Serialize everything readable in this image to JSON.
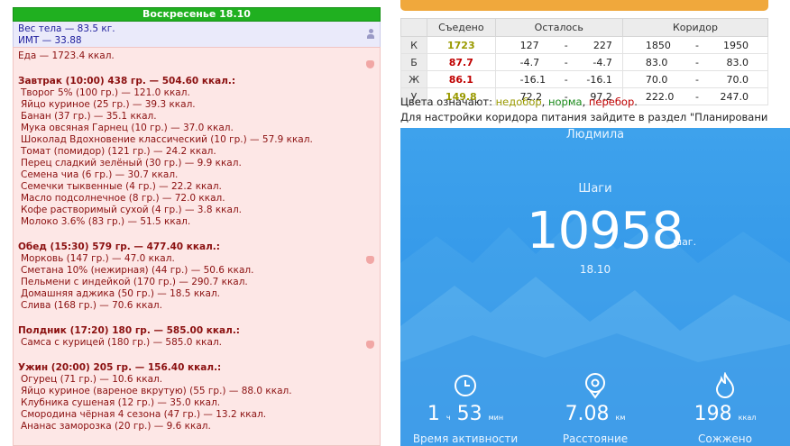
{
  "day_header": "Воскресенье 18.10",
  "weight": {
    "line1": "Вес тела — 83.5 кг.",
    "line2": "ИМТ — 33.88"
  },
  "food_total": "Еда — 1723.4 ккал.",
  "meals": [
    {
      "title": "Завтрак (10:00) 438 гр. — 504.60 ккал.:",
      "items": [
        "Творог 5% (100 гр.) — 121.0 ккал.",
        "Яйцо куриное (25 гр.) — 39.3 ккал.",
        "Банан (37 гр.) — 35.1 ккал.",
        "Мука овсяная Гарнец (10 гр.) — 37.0 ккал.",
        "Шоколад Вдохновение классический (10 гр.) — 57.9 ккал.",
        "Томат (помидор) (121 гр.) — 24.2 ккал.",
        "Перец сладкий зелёный (30 гр.) — 9.9 ккал.",
        "Семена чиа (6 гр.) — 30.7 ккал.",
        "Семечки тыквенные (4 гр.) — 22.2 ккал.",
        "Масло подсолнечное (8 гр.) — 72.0 ккал.",
        "Кофе растворимый сухой (4 гр.) — 3.8 ккал.",
        "Молоко 3.6% (83 гр.) — 51.5 ккал."
      ]
    },
    {
      "title": "Обед (15:30) 579 гр. — 477.40 ккал.:",
      "items": [
        "Морковь (147 гр.) — 47.0 ккал.",
        "Сметана 10% (нежирная) (44 гр.) — 50.6 ккал.",
        "Пельмени с индейкой (170 гр.) — 290.7 ккал.",
        "Домашняя аджика (50 гр.) — 18.5 ккал.",
        "Слива (168 гр.) — 70.6 ккал."
      ]
    },
    {
      "title": "Полдник (17:20) 180 гр. — 585.00 ккал.:",
      "items": [
        "Самса с курицей (180 гр.) — 585.0 ккал."
      ]
    },
    {
      "title": "Ужин (20:00) 205 гр. — 156.40 ккал.:",
      "items": [
        "Огурец (71 гр.) — 10.6 ккал.",
        "Яйцо куриное (вареное вкрутую) (55 гр.) — 88.0 ккал.",
        "Клубника сушеная (12 гр.) — 35.0 ккал.",
        "Смородина чёрная 4 сезона (47 гр.) — 13.2 ккал.",
        "Ананас заморозка (20 гр.) — 9.6 ккал."
      ]
    }
  ],
  "summary": {
    "headers": [
      "Съедено",
      "Осталось",
      "Коридор"
    ],
    "rows": [
      {
        "label": "К",
        "eaten": "1723",
        "eaten_color": "#9a9a00",
        "left_a": "127",
        "left_b": "227",
        "corr_a": "1850",
        "corr_b": "1950"
      },
      {
        "label": "Б",
        "eaten": "87.7",
        "eaten_color": "#c00000",
        "left_a": "-4.7",
        "left_b": "-4.7",
        "corr_a": "83.0",
        "corr_b": "83.0"
      },
      {
        "label": "Ж",
        "eaten": "86.1",
        "eaten_color": "#c00000",
        "left_a": "-16.1",
        "left_b": "-16.1",
        "corr_a": "70.0",
        "corr_b": "70.0"
      },
      {
        "label": "У",
        "eaten": "149.8",
        "eaten_color": "#9a9a00",
        "left_a": "72.2",
        "left_b": "97.2",
        "corr_a": "222.0",
        "corr_b": "247.0"
      }
    ],
    "dash": "-"
  },
  "legend": {
    "prefix": "Цвета означают:",
    "deficit": "недобор",
    "norm": "норма",
    "excess": "перебор",
    "sep": ",",
    "end": ".",
    "deficit_color": "#9a9a00",
    "norm_color": "#1a8a1a",
    "excess_color": "#c00000"
  },
  "note": "Для настройки коридора питания зайдите в раздел \"Планирование питания\"",
  "phone": {
    "user_name": "Людмила",
    "steps_label": "Шаги",
    "steps_value": "10958",
    "steps_unit": "шаг.",
    "date": "18.10",
    "stats": [
      {
        "icon": "clock-icon",
        "value_main": "1",
        "unit1": "ч",
        "value_sec": "53",
        "unit2": "мин",
        "label": "Время активности"
      },
      {
        "icon": "location-icon",
        "value_main": "7.08",
        "unit1": "км",
        "label": "Расстояние"
      },
      {
        "icon": "flame-icon",
        "value_main": "198",
        "unit1": "ккал",
        "label": "Сожжено"
      }
    ]
  }
}
